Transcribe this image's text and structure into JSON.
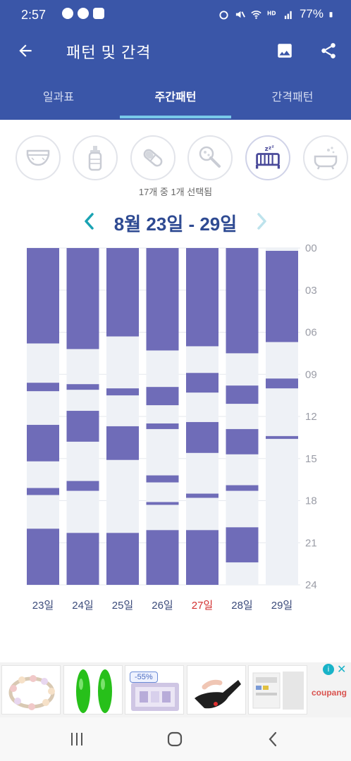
{
  "status_bar": {
    "time": "2:57",
    "battery": "77%"
  },
  "app_bar": {
    "title": "패턴 및 간격"
  },
  "tabs": [
    {
      "label": "일과표",
      "active": false
    },
    {
      "label": "주간패턴",
      "active": true
    },
    {
      "label": "간격패턴",
      "active": false
    }
  ],
  "categories": [
    {
      "icon": "diaper-icon",
      "selected": false
    },
    {
      "icon": "bottle-icon",
      "selected": false
    },
    {
      "icon": "pill-icon",
      "selected": false
    },
    {
      "icon": "rattle-icon",
      "selected": false
    },
    {
      "icon": "crib-sleep-icon",
      "selected": true
    },
    {
      "icon": "bathtub-icon",
      "selected": false
    }
  ],
  "selection_text": "17개 중 1개 선택됨",
  "week": {
    "label": "8월 23일 - 29일"
  },
  "colors": {
    "header": "#3a56a8",
    "bar": "#6f6cb8",
    "track": "#eef1f6",
    "accent": "#1aa3b3",
    "sunday": "#d32f2f",
    "day_label": "#3a4a7a"
  },
  "chart_data": {
    "type": "bar",
    "orientation": "vertical-timeline",
    "y_ticks": [
      "00",
      "03",
      "06",
      "09",
      "12",
      "15",
      "18",
      "21",
      "24"
    ],
    "ylim": [
      0,
      24
    ],
    "days": [
      {
        "label": "23일",
        "highlight": false,
        "intervals": [
          [
            0,
            6.8
          ],
          [
            9.6,
            10.2
          ],
          [
            12.6,
            15.2
          ],
          [
            17.1,
            17.6
          ],
          [
            20.0,
            24.0
          ]
        ]
      },
      {
        "label": "24일",
        "highlight": false,
        "intervals": [
          [
            0,
            7.2
          ],
          [
            9.7,
            10.1
          ],
          [
            11.6,
            13.8
          ],
          [
            16.6,
            17.3
          ],
          [
            20.3,
            24.0
          ]
        ]
      },
      {
        "label": "25일",
        "highlight": false,
        "intervals": [
          [
            0,
            6.3
          ],
          [
            10.0,
            10.5
          ],
          [
            12.7,
            15.1
          ],
          [
            20.3,
            24.0
          ]
        ]
      },
      {
        "label": "26일",
        "highlight": false,
        "intervals": [
          [
            0,
            7.3
          ],
          [
            9.9,
            11.2
          ],
          [
            12.5,
            12.9
          ],
          [
            16.2,
            16.7
          ],
          [
            18.1,
            18.3
          ],
          [
            20.1,
            24.0
          ]
        ]
      },
      {
        "label": "27일",
        "highlight": true,
        "intervals": [
          [
            0,
            7.0
          ],
          [
            8.9,
            10.3
          ],
          [
            12.4,
            14.6
          ],
          [
            17.5,
            17.8
          ],
          [
            20.1,
            24.0
          ]
        ]
      },
      {
        "label": "28일",
        "highlight": false,
        "intervals": [
          [
            0,
            7.5
          ],
          [
            9.8,
            11.1
          ],
          [
            12.9,
            14.7
          ],
          [
            16.9,
            17.3
          ],
          [
            19.9,
            22.4
          ]
        ]
      },
      {
        "label": "29일",
        "highlight": false,
        "intervals": [
          [
            0.2,
            6.7
          ],
          [
            9.3,
            10.0
          ],
          [
            13.4,
            13.6
          ]
        ]
      }
    ]
  },
  "ad": {
    "discount_badge": "-55%",
    "brand": "coupang",
    "info": "i",
    "close": "✕"
  }
}
